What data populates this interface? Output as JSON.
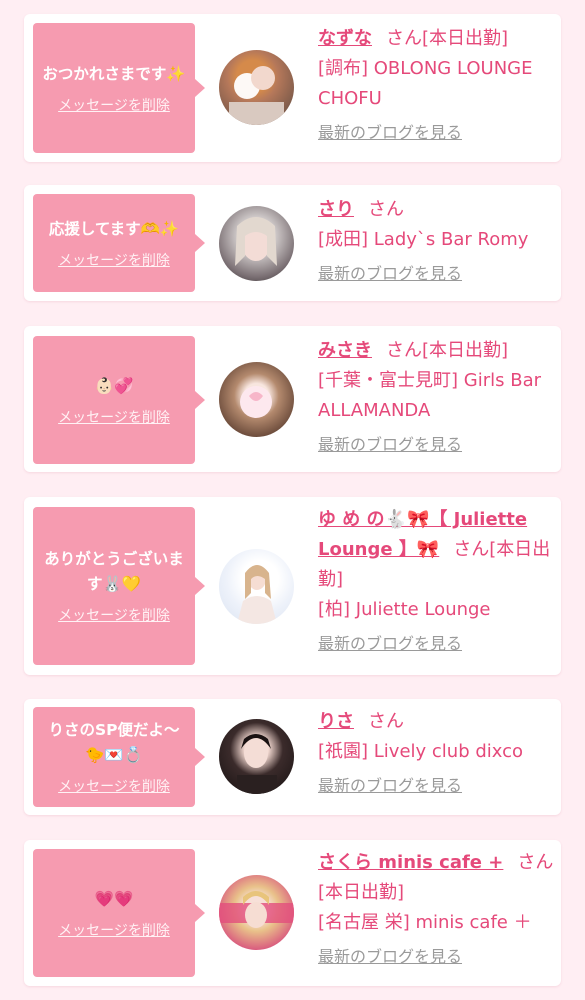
{
  "accent_color": "#e5497a",
  "bubble_color": "#f69bb0",
  "entries": [
    {
      "message": "おつかれさまです✨",
      "delete_label": "メッセージを削除",
      "name": "なずな",
      "honorific": "さん",
      "status": "[本日出勤]",
      "shop": "[調布] OBLONG LOUNGE CHOFU",
      "blog_label": "最新のブログを見る"
    },
    {
      "message": "応援してます🫶✨",
      "delete_label": "メッセージを削除",
      "name": "さり",
      "honorific": "さん",
      "status": "",
      "shop": "[成田] Lady`s Bar Romy",
      "blog_label": "最新のブログを見る"
    },
    {
      "message": "👶🏻💞",
      "delete_label": "メッセージを削除",
      "name": "みさき",
      "honorific": "さん",
      "status": "[本日出勤]",
      "shop": "[千葉・富士見町] Girls Bar ALLAMANDA",
      "blog_label": "最新のブログを見る"
    },
    {
      "message": "ありがとうございます🐰💛",
      "delete_label": "メッセージを削除",
      "name": "ゆ め の🐇🎀【 Juliette Lounge 】🎀",
      "honorific": "さん",
      "status": "[本日出勤]",
      "shop": "[柏] Juliette Lounge",
      "blog_label": "最新のブログを見る"
    },
    {
      "message": "りさのSP便だよ〜🐤💌💍",
      "delete_label": "メッセージを削除",
      "name": "りさ",
      "honorific": "さん",
      "status": "",
      "shop": "[祇園] Lively club dixco",
      "blog_label": "最新のブログを見る"
    },
    {
      "message": "💗💗",
      "delete_label": "メッセージを削除",
      "name": "さくら minis cafe +",
      "honorific": "さん",
      "status": "[本日出勤]",
      "shop": "[名古屋 栄] minis cafe ＋",
      "blog_label": "最新のブログを見る"
    }
  ]
}
